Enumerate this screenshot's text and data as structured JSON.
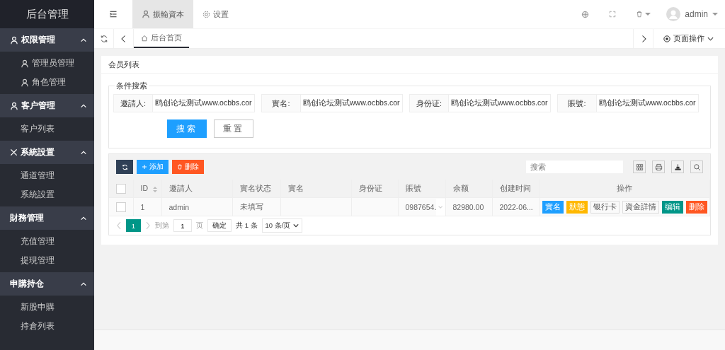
{
  "sidebar": {
    "title": "后台管理",
    "groups": [
      {
        "label": "权限管理",
        "expanded": true,
        "items": [
          {
            "label": "管理员管理"
          },
          {
            "label": "角色管理"
          }
        ]
      },
      {
        "label": "客户管理",
        "expanded": true,
        "items": [
          {
            "label": "客户列表"
          }
        ]
      },
      {
        "label": "系統設置",
        "expanded": true,
        "items": [
          {
            "label": "通道管理"
          },
          {
            "label": "系統設置"
          }
        ]
      },
      {
        "label": "財務管理",
        "expanded": true,
        "items": [
          {
            "label": "充值管理"
          },
          {
            "label": "提現管理"
          }
        ]
      },
      {
        "label": "申購持仓",
        "expanded": true,
        "items": [
          {
            "label": "新股申購"
          },
          {
            "label": "持倉列表"
          }
        ]
      }
    ]
  },
  "header": {
    "tabs": [
      {
        "label": "振輸資本",
        "selected": true
      },
      {
        "label": "设置",
        "selected": false
      }
    ],
    "user": "admin"
  },
  "page_tabs": {
    "tabs": [
      {
        "label": "后台首页",
        "selected": true
      }
    ],
    "page_actions": "页面操作"
  },
  "panel": {
    "title": "会员列表",
    "search": {
      "legend": "条件搜索",
      "fields": [
        {
          "label": "邀請人:",
          "value": "鸥创论坛测试www.ocbbs.cor"
        },
        {
          "label": "實名:",
          "value": "鸥创论坛测试www.ocbbs.cor"
        },
        {
          "label": "身份证:",
          "value": "鸥创论坛测试www.ocbbs.cor"
        },
        {
          "label": "賬號:",
          "value": "鸥创论坛测试www.ocbbs.cor"
        }
      ],
      "search_button": "搜索",
      "reset_button": "重置"
    },
    "toolbar": {
      "add": "添加",
      "delete": "删除",
      "search_placeholder": "搜索"
    },
    "table": {
      "header_checked": false,
      "columns": [
        {
          "label": "ID",
          "sortable": true
        },
        {
          "label": "邀請人",
          "sortable": false
        },
        {
          "label": "實名状态",
          "sortable": false
        },
        {
          "label": "實名",
          "sortable": false
        },
        {
          "label": "身份证",
          "sortable": false
        },
        {
          "label": "賬號",
          "sortable": false
        },
        {
          "label": "余额",
          "sortable": false
        },
        {
          "label": "创建时间",
          "sortable": false
        },
        {
          "label": "操作",
          "sortable": false
        }
      ],
      "rows": [
        {
          "checked": false,
          "cells": [
            "1",
            "admin",
            "未填写",
            null,
            null,
            "0987654.",
            "82980.00",
            "2022-06..."
          ],
          "actions": [
            {
              "label": "實名",
              "kind": "filled",
              "color": "#1e9fff"
            },
            {
              "label": "狀態",
              "kind": "filled",
              "color": "#ffb800"
            },
            {
              "label": "银行卡",
              "kind": "plain"
            },
            {
              "label": "資金詳情",
              "kind": "plain"
            },
            {
              "label": "编辑",
              "kind": "filled",
              "color": "#009688"
            },
            {
              "label": "删除",
              "kind": "filled",
              "color": "#ff5722"
            }
          ]
        }
      ]
    },
    "pagination": {
      "pages": [
        {
          "label": "1",
          "selected": true
        }
      ],
      "goto_label": "到第",
      "goto_value": "1",
      "page_unit": "页",
      "confirm": "确定",
      "total": "共 1 条",
      "page_size": "10 条/页"
    }
  }
}
